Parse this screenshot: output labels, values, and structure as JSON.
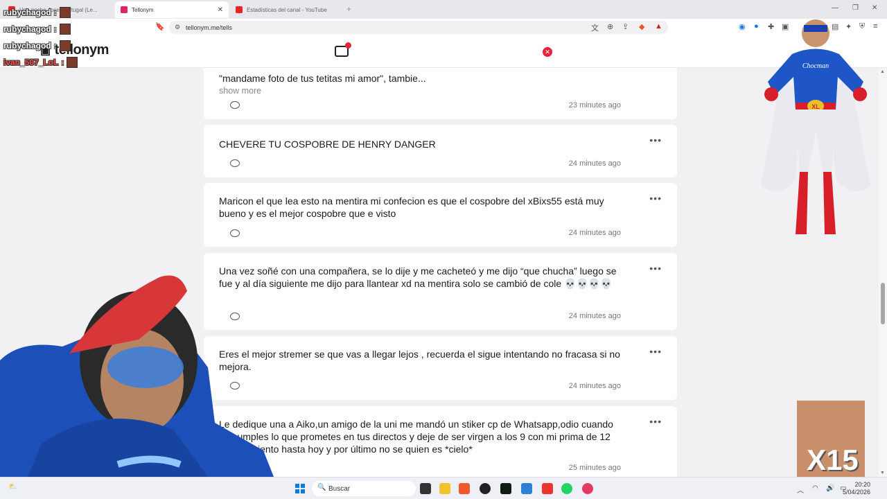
{
  "browser": {
    "tabs": [
      {
        "label": "Una noche Jose, Portugal (Le...",
        "active": false
      },
      {
        "label": "Tellonym",
        "active": true
      },
      {
        "label": "Estadísticas del canal - YouTube Studio",
        "active": false
      }
    ],
    "url": "tellonym.me/tells"
  },
  "site": {
    "logo": "tellonym"
  },
  "tells": [
    {
      "text": "\"mandame foto de tus tetitas mi amor\", tambie...",
      "show_more": "show more",
      "time": "23 minutes ago"
    },
    {
      "text": "CHEVERE TU COSPOBRE DE HENRY DANGER",
      "time": "24 minutes ago"
    },
    {
      "text": "Maricon el que lea esto na mentira mi confecion es que el cospobre del xBixs55 está muy bueno y es el mejor cospobre que e visto",
      "time": "24 minutes ago"
    },
    {
      "text": "Una vez soñé con una compañera, se lo dije y me cacheteó y me dijo “que chucha” luego se fue y al día siguiente me dijo para llantear xd na mentira solo se cambió de cole 💀💀💀💀",
      "time": "24 minutes ago"
    },
    {
      "text": "Eres el mejor stremer se que vas a llegar lejos , recuerda el sigue intentando no fracasa si no mejora.",
      "time": "24 minutes ago"
    },
    {
      "text": "Le dedique una a Aiko,un amigo de la uni me mandó un stiker cp de Whatsapp,odio cuando no cumples lo que prometes en tus directos y deje de ser virgen a los 9 con mi prima de 12 me arrepiento hasta hoy y por último no se quien es *cielo*",
      "time": "25 minutes ago"
    }
  ],
  "overlay": {
    "chat": [
      "rubychagod",
      "rubychagod",
      "rubychagod",
      "ivan_507_LoL"
    ],
    "hero_label": "Chocman",
    "hero_belt": "XL",
    "meme_label": "X15"
  },
  "taskbar": {
    "search_placeholder": "Buscar",
    "time": "20:20",
    "date": "5/04/2026"
  }
}
